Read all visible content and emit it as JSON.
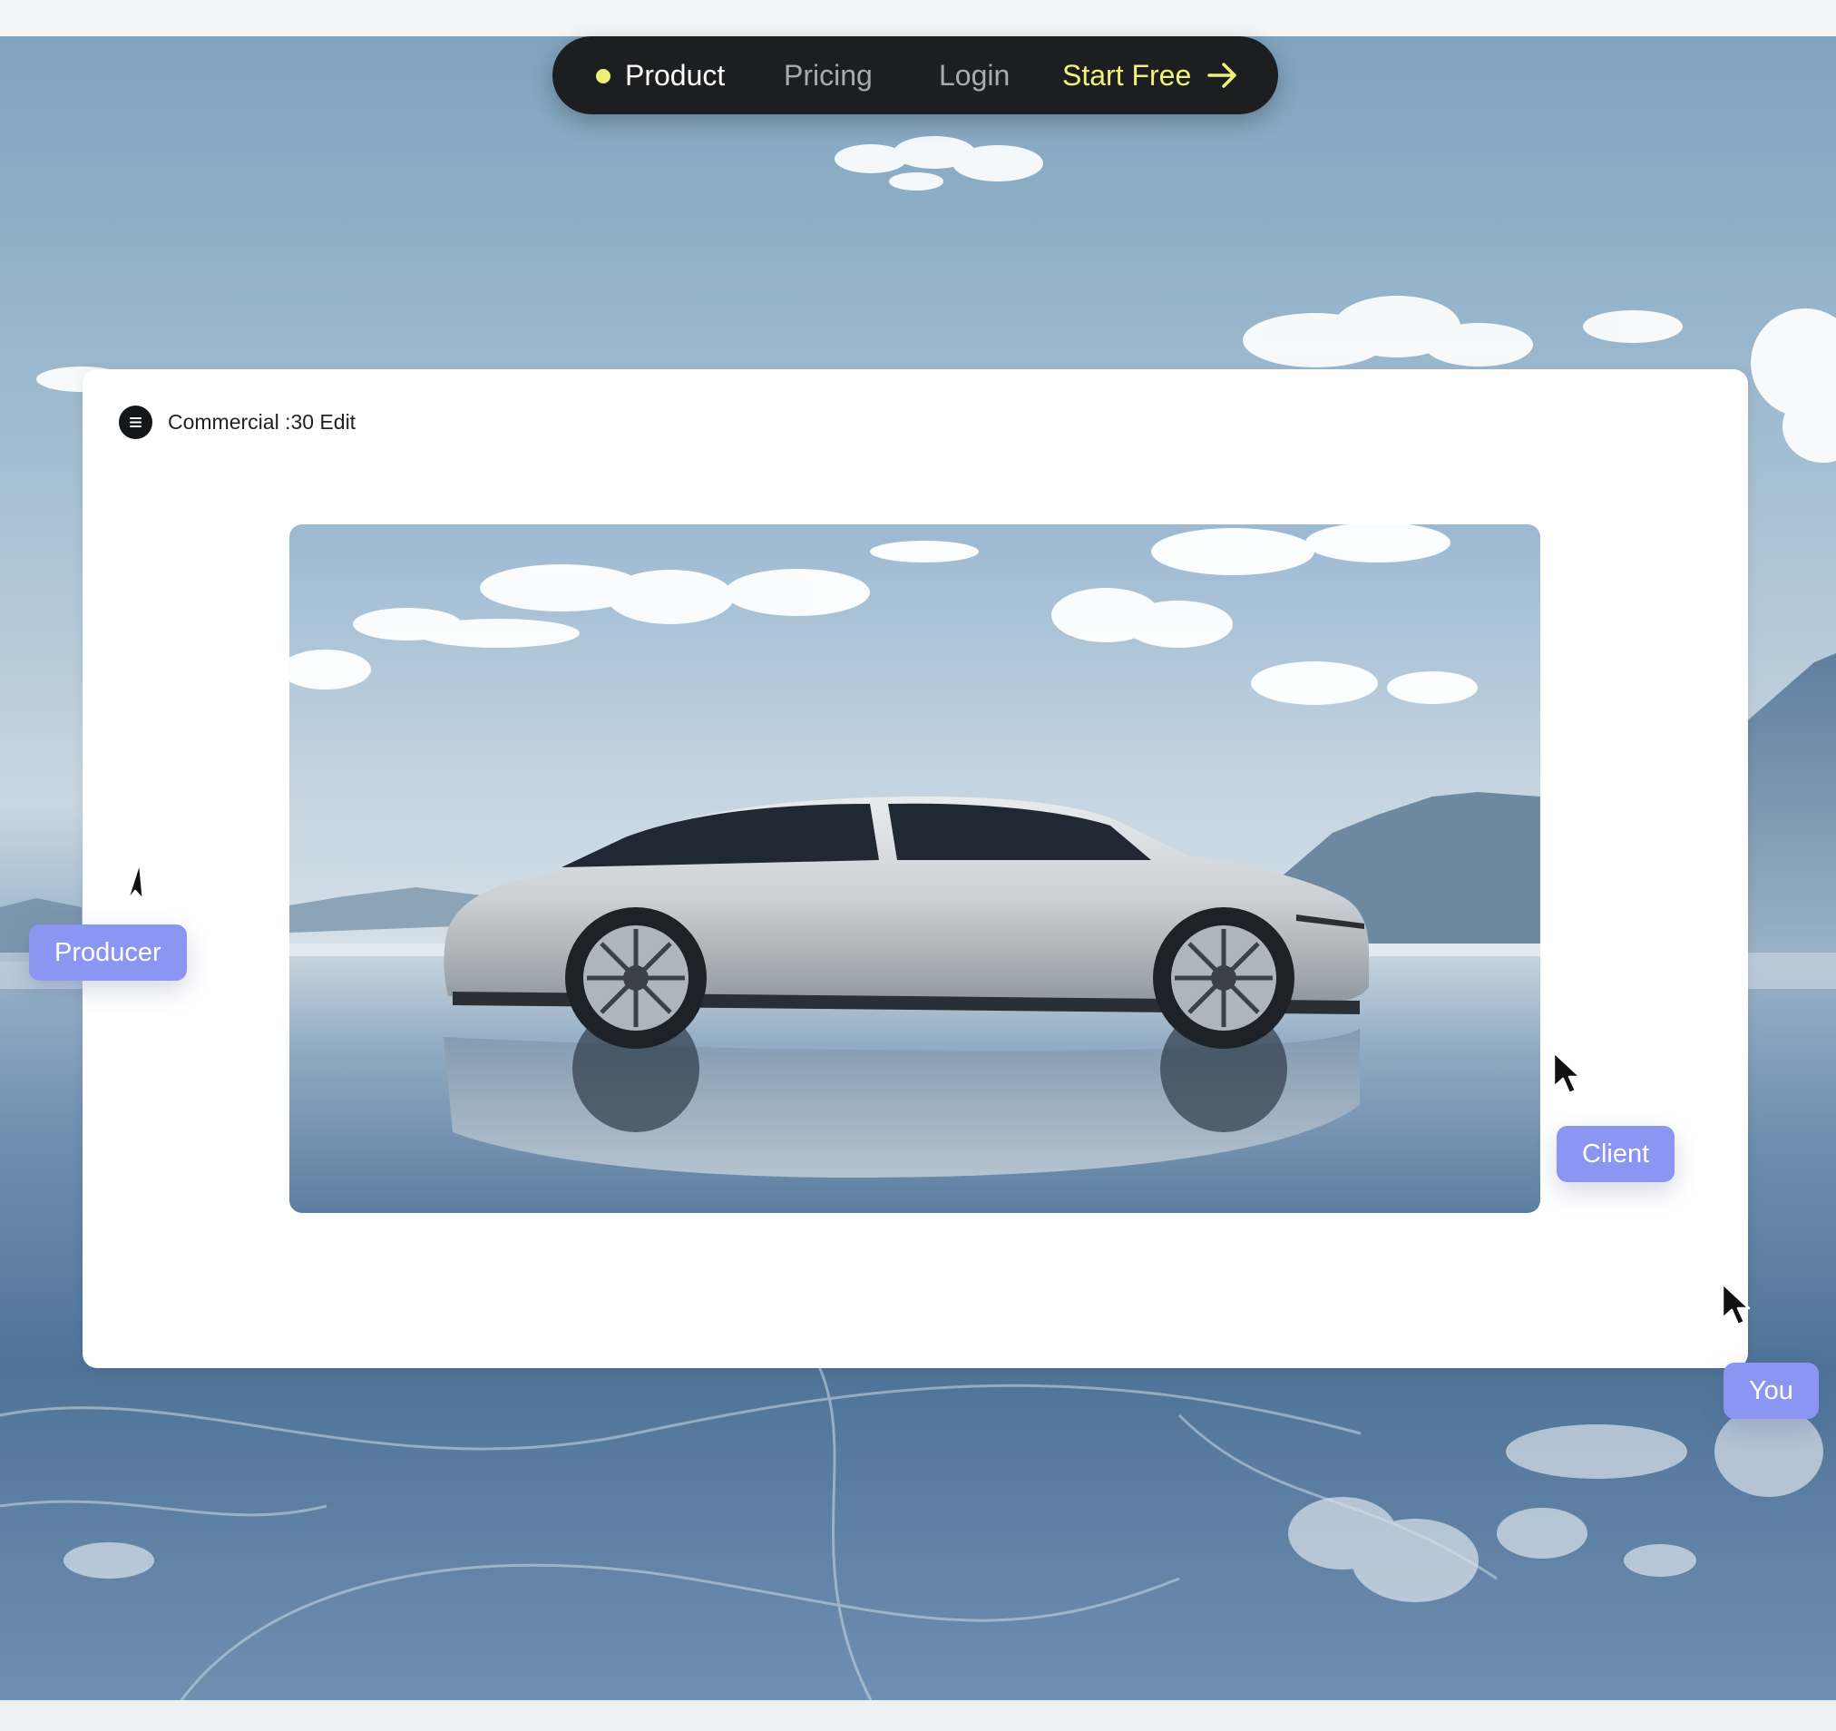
{
  "nav": {
    "product_label": "Product",
    "pricing_label": "Pricing",
    "login_label": "Login",
    "cta_label": "Start Free",
    "cta_icon": "arrow-right-icon",
    "active_indicator_color": "#eef07a"
  },
  "card": {
    "logo_icon": "app-logo-icon",
    "title": "Commercial :30 Edit"
  },
  "collaborators": {
    "producer_label": "Producer",
    "client_label": "Client",
    "you_label": "You",
    "tag_color": "#8b95f2"
  }
}
